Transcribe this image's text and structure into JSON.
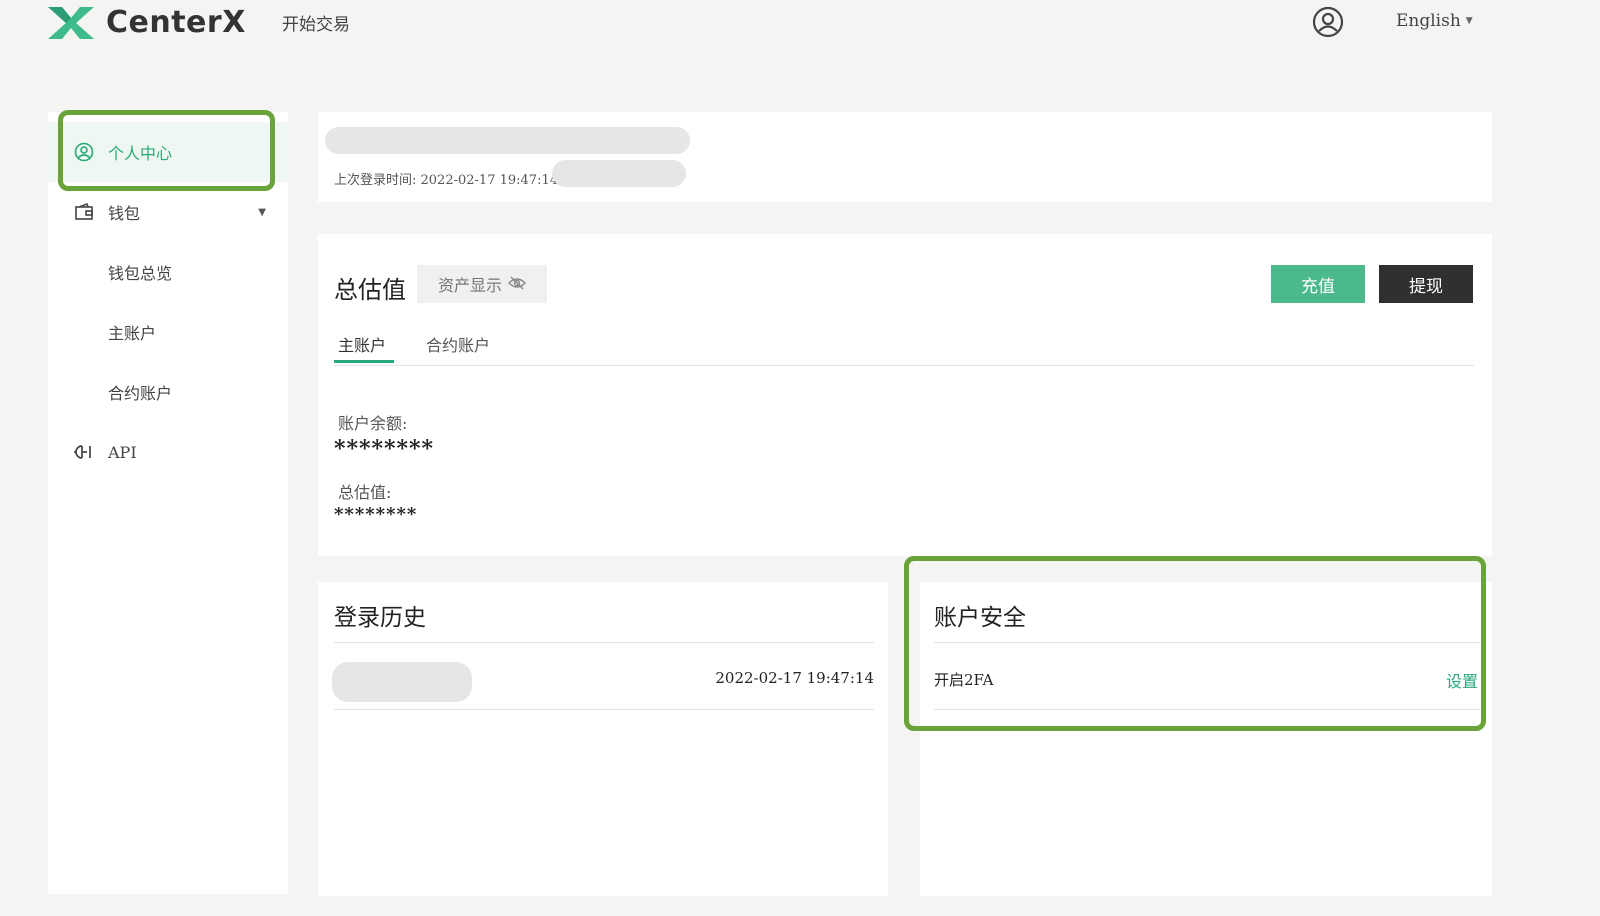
{
  "header": {
    "brand": "CenterX",
    "nav_trade": "开始交易",
    "language": "English",
    "brand_color": "#3dbb8a"
  },
  "sidebar": {
    "items": [
      {
        "label": "个人中心",
        "icon": "user-circle-icon",
        "active": true
      },
      {
        "label": "钱包",
        "icon": "wallet-icon",
        "expandable": true
      },
      {
        "label": "钱包总览"
      },
      {
        "label": "主账户"
      },
      {
        "label": "合约账户"
      },
      {
        "label": "API",
        "icon": "api-plug-icon"
      }
    ]
  },
  "profile": {
    "last_login_label": "上次登录时间: 2022-02-17 19:47:14"
  },
  "assets": {
    "title": "总估值",
    "toggle_label": "资产显示",
    "deposit_label": "充值",
    "withdraw_label": "提现",
    "tabs": [
      "主账户",
      "合约账户"
    ],
    "balance_label": "账户余额:",
    "balance_value": "********",
    "total_label": "总估值:",
    "total_value": "********"
  },
  "login_history": {
    "title": "登录历史",
    "rows": [
      {
        "time": "2022-02-17 19:47:14"
      }
    ]
  },
  "security": {
    "title": "账户安全",
    "rows": [
      {
        "label": "开启2FA",
        "action": "设置"
      }
    ]
  },
  "colors": {
    "accent": "#2aa97a",
    "highlight": "#6aa33a",
    "deposit": "#4cb98c",
    "withdraw": "#2f3130"
  }
}
